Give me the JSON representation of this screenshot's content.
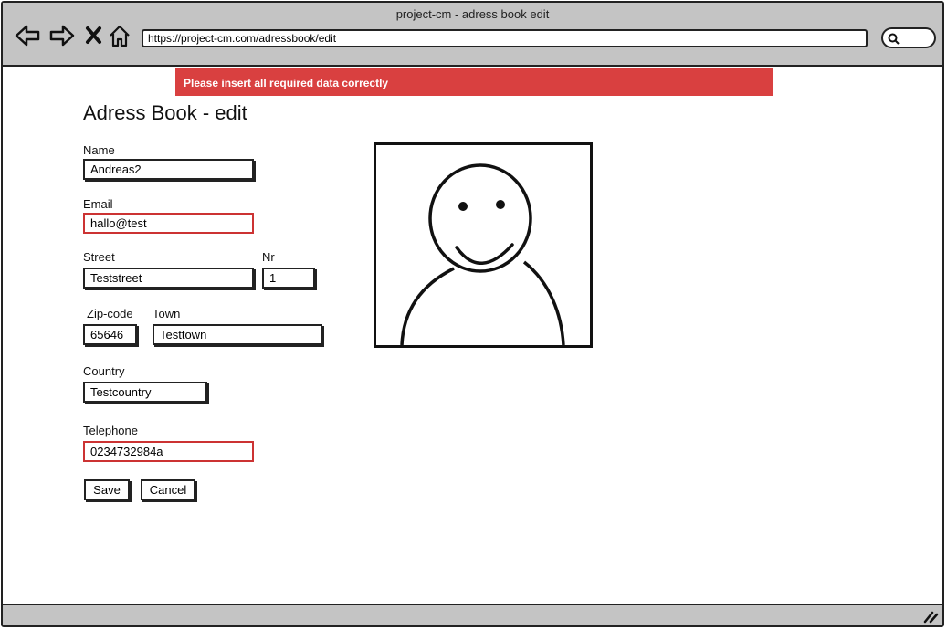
{
  "window": {
    "title": "project-cm - adress book edit"
  },
  "browser": {
    "url": "https://project-cm.com/adressbook/edit",
    "icons": [
      "back-arrow-icon",
      "forward-arrow-icon",
      "close-x-icon",
      "home-icon",
      "search-icon",
      "resize-grip-icon"
    ]
  },
  "alert": {
    "message": "Please insert all required data correctly",
    "color": "#d94040"
  },
  "page": {
    "title": "Adress Book - edit"
  },
  "form": {
    "name": {
      "label": "Name",
      "value": "Andreas2"
    },
    "email": {
      "label": "Email",
      "value": "hallo@test",
      "error": true
    },
    "street": {
      "label": "Street",
      "value": "Teststreet"
    },
    "nr": {
      "label": "Nr",
      "value": "1"
    },
    "zip": {
      "label": "Zip-code",
      "value": "65646"
    },
    "town": {
      "label": "Town",
      "value": "Testtown"
    },
    "country": {
      "label": "Country",
      "value": "Testcountry"
    },
    "telephone": {
      "label": "Telephone",
      "value": "0234732984a",
      "error": true
    },
    "save_label": "Save",
    "cancel_label": "Cancel"
  },
  "colors": {
    "error_border": "#cc3333",
    "chrome": "#c4c4c4"
  }
}
